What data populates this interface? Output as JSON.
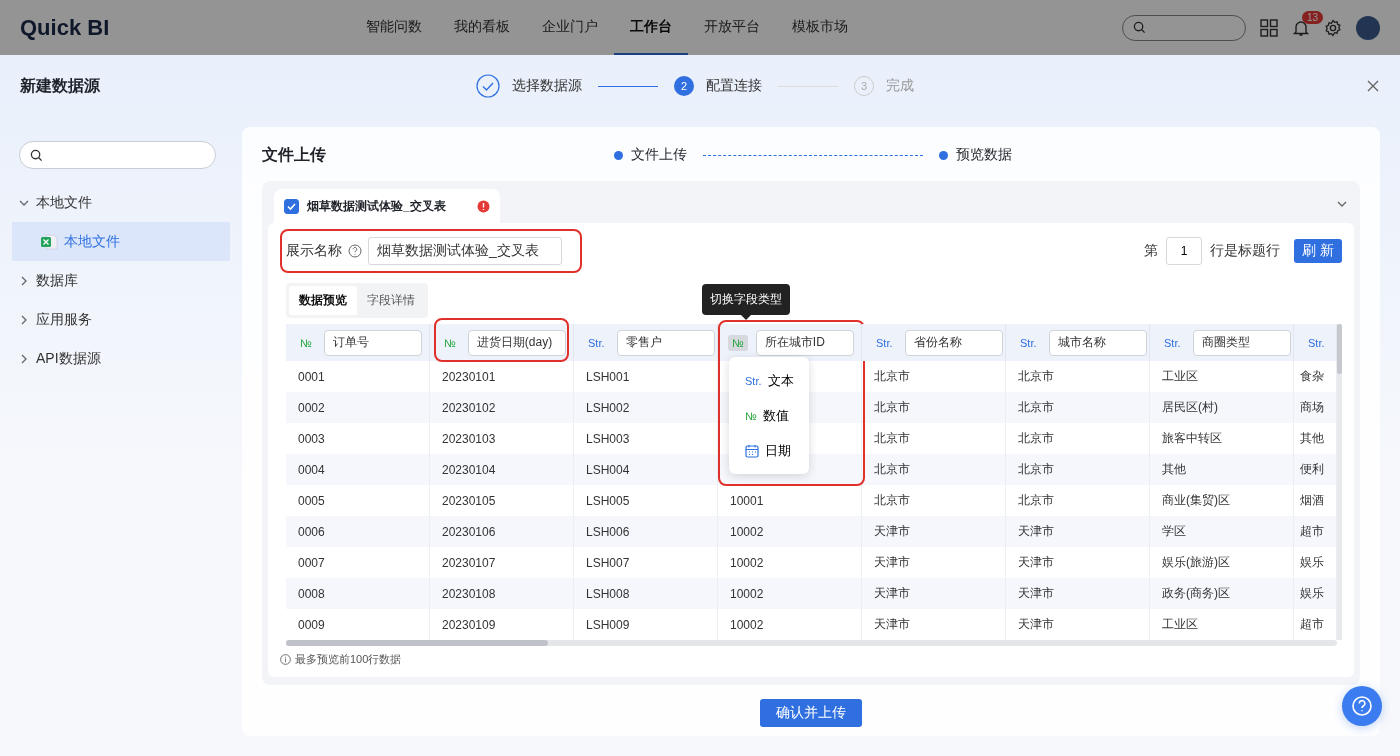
{
  "nav": {
    "logo": "Quick BI",
    "items": [
      {
        "label": "智能问数",
        "selected": false
      },
      {
        "label": "我的看板",
        "selected": false
      },
      {
        "label": "企业门户",
        "selected": false
      },
      {
        "label": "工作台",
        "selected": true
      },
      {
        "label": "开放平台",
        "selected": false
      },
      {
        "label": "模板市场",
        "selected": false
      }
    ],
    "notification_count": "13"
  },
  "modal": {
    "title": "新建数据源",
    "steps": [
      {
        "label": "选择数据源",
        "completed": true,
        "selected": false
      },
      {
        "number": "2",
        "label": "配置连接",
        "completed": false,
        "selected": true
      },
      {
        "number": "3",
        "label": "完成",
        "completed": false,
        "selected": false
      }
    ]
  },
  "sidebar": {
    "items": [
      {
        "label": "本地文件",
        "expanded": true,
        "children": [
          {
            "label": "本地文件",
            "selected": true
          }
        ]
      },
      {
        "label": "数据库",
        "expanded": false
      },
      {
        "label": "应用服务",
        "expanded": false
      },
      {
        "label": "API数据源",
        "expanded": false
      }
    ]
  },
  "content": {
    "title": "文件上传",
    "substeps": [
      "文件上传",
      "预览数据"
    ]
  },
  "file": {
    "name": "烟草数据测试体验_交叉表",
    "checked": true,
    "display_name": {
      "label": "展示名称",
      "value": "烟草数据测试体验_交叉表",
      "highlighted": true
    },
    "header_row": {
      "prefix": "第",
      "value": "1",
      "suffix": "行是标题行"
    },
    "refresh_button": "刷 新"
  },
  "tabs": [
    {
      "label": "数据预览",
      "selected": true
    },
    {
      "label": "字段详情",
      "selected": false
    }
  ],
  "tooltip": "切换字段类型",
  "table": {
    "columns": [
      {
        "kind": "num",
        "type_label": "№",
        "name": "订单号",
        "highlighted": false,
        "menu_open": false
      },
      {
        "kind": "num",
        "type_label": "№",
        "name": "进货日期(day)",
        "highlighted": true,
        "menu_open": false
      },
      {
        "kind": "str",
        "type_label": "Str.",
        "name": "零售户",
        "highlighted": false,
        "menu_open": false
      },
      {
        "kind": "num",
        "type_label": "№",
        "name": "所在城市ID",
        "highlighted": true,
        "menu_open": true
      },
      {
        "kind": "str",
        "type_label": "Str.",
        "name": "省份名称",
        "highlighted": false,
        "menu_open": false
      },
      {
        "kind": "str",
        "type_label": "Str.",
        "name": "城市名称",
        "highlighted": false,
        "menu_open": false
      },
      {
        "kind": "str",
        "type_label": "Str.",
        "name": "商圈类型",
        "highlighted": false,
        "menu_open": false
      },
      {
        "kind": "str",
        "type_label": "Str.",
        "highlighted": false,
        "menu_open": false
      }
    ],
    "rows": [
      [
        "0001",
        "20230101",
        "LSH001",
        null,
        "北京市",
        "北京市",
        "工业区",
        "食杂"
      ],
      [
        "0002",
        "20230102",
        "LSH002",
        null,
        "北京市",
        "北京市",
        "居民区(村)",
        "商场"
      ],
      [
        "0003",
        "20230103",
        "LSH003",
        null,
        "北京市",
        "北京市",
        "旅客中转区",
        "其他"
      ],
      [
        "0004",
        "20230104",
        "LSH004",
        null,
        "北京市",
        "北京市",
        "其他",
        "便利"
      ],
      [
        "0005",
        "20230105",
        "LSH005",
        "10001",
        "北京市",
        "北京市",
        "商业(集贸)区",
        "烟酒"
      ],
      [
        "0006",
        "20230106",
        "LSH006",
        "10002",
        "天津市",
        "天津市",
        "学区",
        "超市"
      ],
      [
        "0007",
        "20230107",
        "LSH007",
        "10002",
        "天津市",
        "天津市",
        "娱乐(旅游)区",
        "娱乐"
      ],
      [
        "0008",
        "20230108",
        "LSH008",
        "10002",
        "天津市",
        "天津市",
        "政务(商务)区",
        "娱乐"
      ],
      [
        "0009",
        "20230109",
        "LSH009",
        "10002",
        "天津市",
        "天津市",
        "工业区",
        "超市"
      ]
    ],
    "type_menu": [
      {
        "kind": "str",
        "icon_text": "Str.",
        "label": "文本"
      },
      {
        "kind": "num",
        "icon_text": "№",
        "label": "数值"
      },
      {
        "kind": "date",
        "label": "日期"
      }
    ],
    "footnote": "最多预览前100行数据"
  },
  "confirm_button": "确认并上传"
}
